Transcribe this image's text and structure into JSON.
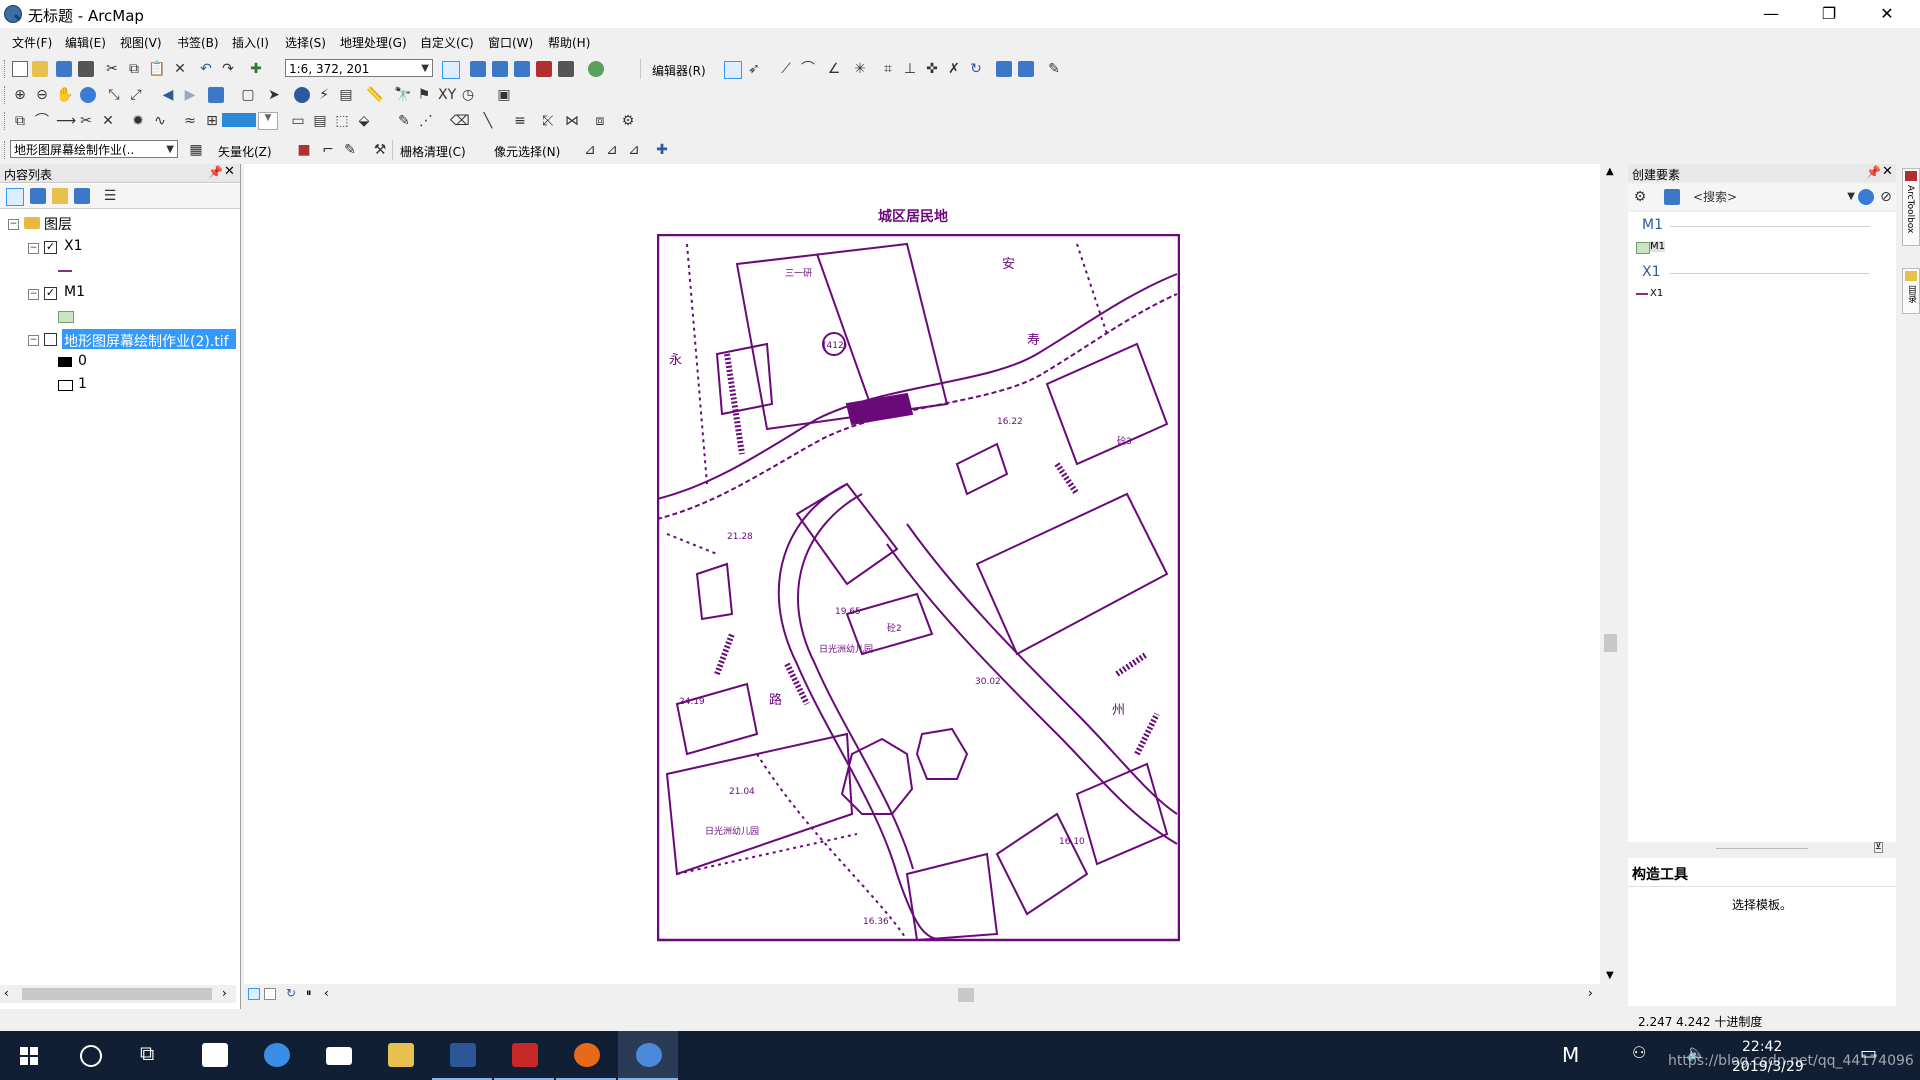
{
  "window": {
    "title": "无标题 - ArcMap",
    "min": "—",
    "restore": "❐",
    "close": "✕"
  },
  "menu": [
    "文件(F)",
    "编辑(E)",
    "视图(V)",
    "书签(B)",
    "插入(I)",
    "选择(S)",
    "地理处理(G)",
    "自定义(C)",
    "窗口(W)",
    "帮助(H)"
  ],
  "toolbar": {
    "scale": "1:6, 372, 201",
    "editor_label": "编辑器(R)",
    "georef_layer": "地形图屏幕绘制作业(..",
    "vectorize_label": "矢量化(Z)",
    "raster_cleanup_label": "栅格清理(C)",
    "cell_select_label": "像元选择(N)"
  },
  "toc": {
    "title": "内容列表",
    "root": "图层",
    "layers": [
      {
        "name": "X1",
        "checked": true,
        "legend": "line"
      },
      {
        "name": "M1",
        "checked": true,
        "legend": "polygon"
      },
      {
        "name": "地形图屏幕绘制作业(2).tif",
        "checked": false,
        "legend": "raster",
        "classes": [
          "0",
          "1"
        ]
      }
    ]
  },
  "map": {
    "title": "城区居民地",
    "labels": {
      "l1": "三一研",
      "l2": "日光洲幼儿园",
      "l3": "日光洲幼儿园",
      "l4": "(412)",
      "l5": "21.28",
      "l6": "30.02",
      "l7": "16.36",
      "l8": "24.19",
      "l9": "16.22",
      "l10": "16.10",
      "l11": "21.04",
      "l12": "19.65",
      "l13": "砼3",
      "l14": "砼2",
      "l15": "永",
      "l16": "寿",
      "l17": "路",
      "l18": "州",
      "l19": "安"
    },
    "color": "#6a0a7a"
  },
  "create_features": {
    "title": "创建要素",
    "search_placeholder": "<搜索>",
    "groups": [
      {
        "name": "M1",
        "item": "M1",
        "type": "polygon"
      },
      {
        "name": "X1",
        "item": "X1",
        "type": "line"
      }
    ],
    "side_tabs": [
      "ArcToolbox",
      "目录"
    ]
  },
  "construction_tools": {
    "title": "构造工具",
    "hint": "选择模板。"
  },
  "status": {
    "coords": "2.247  4.242 十进制度"
  },
  "taskbar": {
    "time": "22:42",
    "date": "2019/3/29",
    "ime": "M",
    "watermark": "https://blog.csdn.net/qq_44174096"
  },
  "colors": {
    "accent": "#3399ff",
    "map_ink": "#6a0a7a",
    "taskbar": "#101f33",
    "polygon_legend": "#c8e6c0"
  }
}
